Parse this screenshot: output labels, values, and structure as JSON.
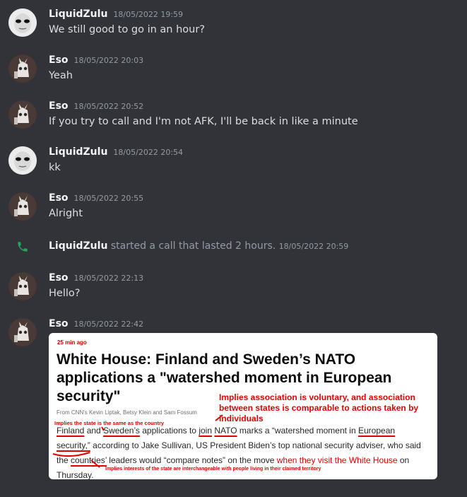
{
  "messages": [
    {
      "author": "LiquidZulu",
      "timestamp": "18/05/2022 19:59",
      "text": "We still good to go in an hour?"
    },
    {
      "author": "Eso",
      "timestamp": "18/05/2022 20:03",
      "text": "Yeah"
    },
    {
      "author": "Eso",
      "timestamp": "18/05/2022 20:52",
      "text": "If you try to call and I'm not AFK, I'll be back in like a minute"
    },
    {
      "author": "LiquidZulu",
      "timestamp": "18/05/2022 20:54",
      "text": "kk"
    },
    {
      "author": "Eso",
      "timestamp": "18/05/2022 20:55",
      "text": "Alright"
    },
    {
      "author": "Eso",
      "timestamp": "18/05/2022 22:13",
      "text": "Hello?"
    },
    {
      "author": "Eso",
      "timestamp": "18/05/2022 22:42",
      "text": ""
    }
  ],
  "call": {
    "author": "LiquidZulu",
    "text": "started a call that lasted 2 hours.",
    "timestamp": "18/05/2022 20:59",
    "icon": "phone-icon"
  },
  "article": {
    "ago": "25 min ago",
    "headline": "White House: Finland and Sweden’s NATO applications a \"watershed moment in European security\"",
    "byline": "From CNN's Kevin Liptak, Betsy Klein and Sam Fossum",
    "body": {
      "p1": "Finland",
      "p2": "and",
      "p3": "Sweden’s",
      "p4": "applications to",
      "p5": "join",
      "p6": "NATO",
      "p7": "marks a “watershed moment in",
      "p8": "European security,”",
      "p9": "according to Jake Sullivan, US President Biden’s top national security adviser, who said the",
      "p10": "countries’",
      "p11": "leaders would “compare notes” on the move",
      "p12": "when they visit the White House",
      "p13": "on Thursday."
    },
    "annotations": {
      "a1": "Implies association is voluntary, and association between states is comparable to actions taken by individuals",
      "a2": "Implies the state is the same as the country",
      "a3": "Implies interests of the state are interchangeable with people living in their claimed territory"
    }
  },
  "colors": {
    "background": "#313338",
    "annotation": "#e00000",
    "call_icon": "#23a559"
  }
}
